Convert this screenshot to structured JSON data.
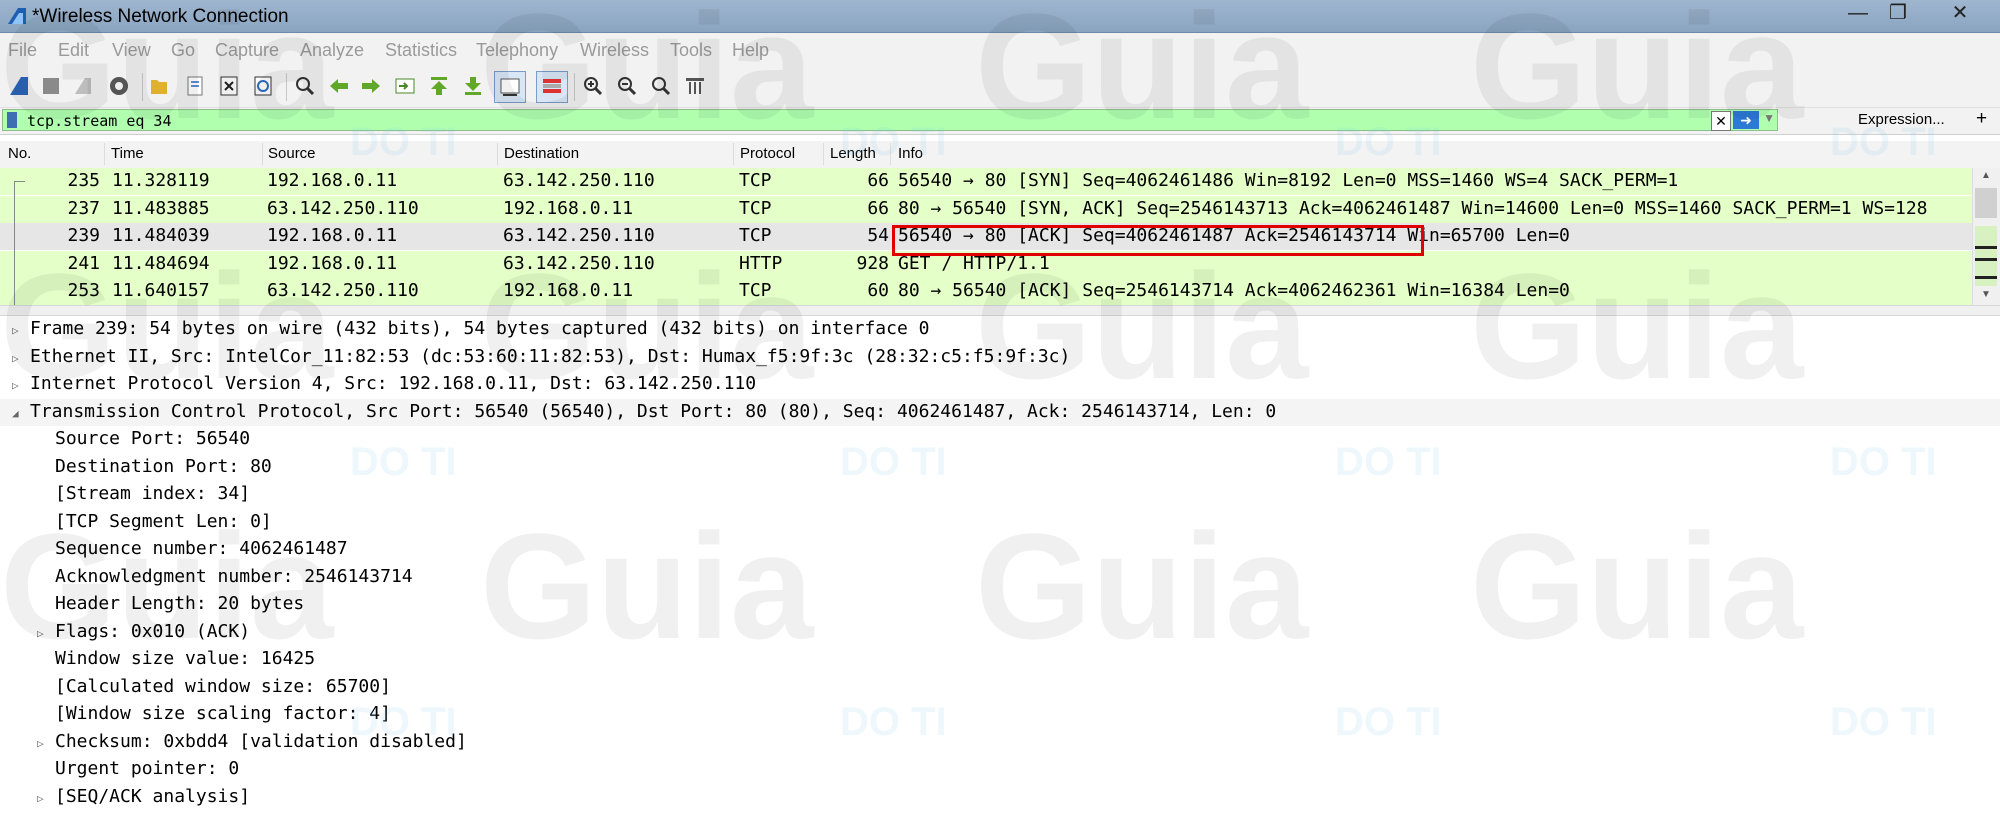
{
  "window": {
    "title": "*Wireless Network Connection",
    "controls": [
      "minimize-icon",
      "restore-icon",
      "close-icon"
    ]
  },
  "menu": [
    "File",
    "Edit",
    "View",
    "Go",
    "Capture",
    "Analyze",
    "Statistics",
    "Telephony",
    "Wireless",
    "Tools",
    "Help"
  ],
  "filter": {
    "value": "tcp.stream eq 34",
    "expression_label": "Expression...",
    "add_label": "+"
  },
  "packet_list": {
    "columns": [
      "No.",
      "Time",
      "Source",
      "Destination",
      "Protocol",
      "Length",
      "Info"
    ],
    "rows": [
      {
        "no": "235",
        "time": "11.328119",
        "source": "192.168.0.11",
        "destination": "63.142.250.110",
        "protocol": "TCP",
        "length": "66",
        "info": "56540 → 80 [SYN] Seq=4062461486 Win=8192 Len=0 MSS=1460 WS=4 SACK_PERM=1",
        "selected": false
      },
      {
        "no": "237",
        "time": "11.483885",
        "source": "63.142.250.110",
        "destination": "192.168.0.11",
        "protocol": "TCP",
        "length": "66",
        "info": "80 → 56540 [SYN, ACK] Seq=2546143713 Ack=4062461487 Win=14600 Len=0 MSS=1460 SACK_PERM=1 WS=128",
        "selected": false
      },
      {
        "no": "239",
        "time": "11.484039",
        "source": "192.168.0.11",
        "destination": "63.142.250.110",
        "protocol": "TCP",
        "length": "54",
        "info": "56540 → 80 [ACK] Seq=4062461487 Ack=2546143714 Win=65700 Len=0",
        "selected": true
      },
      {
        "no": "241",
        "time": "11.484694",
        "source": "192.168.0.11",
        "destination": "63.142.250.110",
        "protocol": "HTTP",
        "length": "928",
        "info": "GET / HTTP/1.1",
        "selected": false
      },
      {
        "no": "253",
        "time": "11.640157",
        "source": "63.142.250.110",
        "destination": "192.168.0.11",
        "protocol": "TCP",
        "length": "60",
        "info": "80 → 56540 [ACK] Seq=2546143714 Ack=4062462361 Win=16384 Len=0",
        "selected": false
      }
    ]
  },
  "details": [
    {
      "text": "Frame 239: 54 bytes on wire (432 bits), 54 bytes captured (432 bits) on interface 0",
      "level": 0,
      "toggle": "collapsed"
    },
    {
      "text": "Ethernet II, Src: IntelCor_11:82:53 (dc:53:60:11:82:53), Dst: Humax_f5:9f:3c (28:32:c5:f5:9f:3c)",
      "level": 0,
      "toggle": "collapsed"
    },
    {
      "text": "Internet Protocol Version 4, Src: 192.168.0.11, Dst: 63.142.250.110",
      "level": 0,
      "toggle": "collapsed"
    },
    {
      "text": "Transmission Control Protocol, Src Port: 56540 (56540), Dst Port: 80 (80), Seq: 4062461487, Ack: 2546143714, Len: 0",
      "level": 0,
      "toggle": "expanded"
    },
    {
      "text": "Source Port: 56540",
      "level": 1,
      "toggle": "none"
    },
    {
      "text": "Destination Port: 80",
      "level": 1,
      "toggle": "none"
    },
    {
      "text": "[Stream index: 34]",
      "level": 1,
      "toggle": "none"
    },
    {
      "text": "[TCP Segment Len: 0]",
      "level": 1,
      "toggle": "none"
    },
    {
      "text": "Sequence number: 4062461487",
      "level": 1,
      "toggle": "none"
    },
    {
      "text": "Acknowledgment number: 2546143714",
      "level": 1,
      "toggle": "none"
    },
    {
      "text": "Header Length: 20 bytes",
      "level": 1,
      "toggle": "none"
    },
    {
      "text": "Flags: 0x010 (ACK)",
      "level": 1,
      "toggle": "collapsed"
    },
    {
      "text": "Window size value: 16425",
      "level": 1,
      "toggle": "none"
    },
    {
      "text": "[Calculated window size: 65700]",
      "level": 1,
      "toggle": "none"
    },
    {
      "text": "[Window size scaling factor: 4]",
      "level": 1,
      "toggle": "none"
    },
    {
      "text": "Checksum: 0xbdd4 [validation disabled]",
      "level": 1,
      "toggle": "collapsed"
    },
    {
      "text": "Urgent pointer: 0",
      "level": 1,
      "toggle": "none"
    },
    {
      "text": "[SEQ/ACK analysis]",
      "level": 1,
      "toggle": "collapsed"
    }
  ],
  "watermark": {
    "big": "Guia",
    "small": "DO TI"
  },
  "colors": {
    "tcp_row": "#e4ffc7",
    "selected_row": "#e6e6e6",
    "highlight": "#e00000",
    "filter_bg": "#afffaf"
  }
}
